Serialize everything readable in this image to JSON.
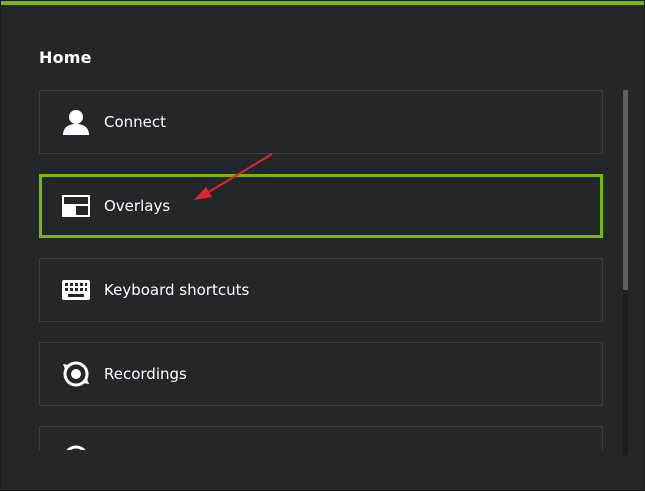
{
  "page": {
    "section_title": "Home"
  },
  "colors": {
    "accent": "#76b900",
    "panel_bg": "#24272a",
    "card_border": "#3b3f44",
    "arrow": "#e0252b"
  },
  "menu": {
    "items": [
      {
        "label": "Connect",
        "icon": "person-icon",
        "selected": false
      },
      {
        "label": "Overlays",
        "icon": "overlay-layout-icon",
        "selected": true
      },
      {
        "label": "Keyboard shortcuts",
        "icon": "keyboard-icon",
        "selected": false
      },
      {
        "label": "Recordings",
        "icon": "recordings-icon",
        "selected": false
      },
      {
        "label": "",
        "icon": "partially-visible-icon",
        "selected": false
      }
    ]
  },
  "scrollbar": {
    "position_fraction": 0.0
  }
}
